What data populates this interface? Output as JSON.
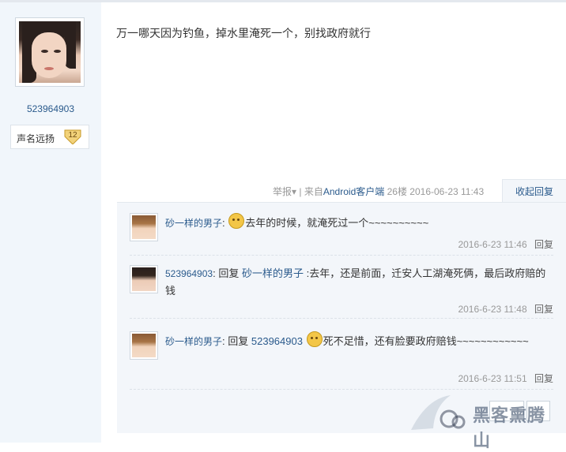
{
  "author": {
    "username": "523964903",
    "rank_label": "声名远扬",
    "rank_level": "12"
  },
  "post": {
    "content": "万一哪天因为钓鱼，掉水里淹死一个，别找政府就行",
    "report": "举报",
    "client_prefix": "来自",
    "client": "Android客户端",
    "floor": "26楼",
    "date": "2016-06-23 11:43",
    "collapse_label": "收起回复"
  },
  "replies": [
    {
      "user": "砂一样的男子",
      "reply_to": "",
      "text": "去年的时候，就淹死过一个~~~~~~~~~~",
      "has_emoji": true,
      "time": "2016-6-23 11:46",
      "reply_label": "回复"
    },
    {
      "user": "523964903",
      "reply_to": "砂一样的男子",
      "text": ":去年，还是前面，迁安人工湖淹死俩，最后政府赔的钱",
      "has_emoji": false,
      "time": "2016-6-23 11:48",
      "reply_label": "回复"
    },
    {
      "user": "砂一样的男子",
      "reply_to": "523964903",
      "text": "死不足惜，还有脸要政府赔钱~~~~~~~~~~~~",
      "has_emoji": true,
      "time": "2016-6-23 11:51",
      "reply_label": "回复"
    }
  ],
  "reply_prefix": "回复",
  "watermark": "黑客熏腾山",
  "colors": {
    "link": "#2a5a8c",
    "sidebar_bg": "#f1f6fb",
    "reply_bg": "#f3f6fa"
  }
}
